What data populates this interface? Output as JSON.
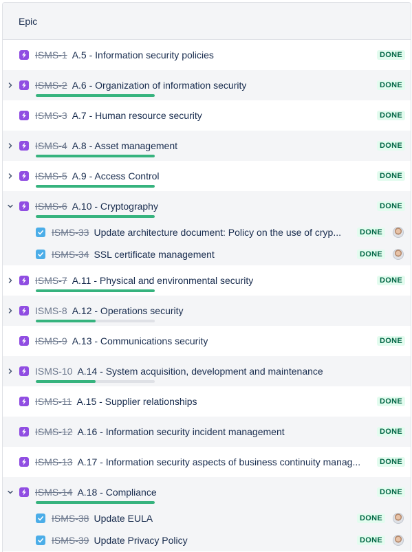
{
  "header": {
    "label": "Epic"
  },
  "status_done": "DONE",
  "colors": {
    "epic": "#904ee2",
    "task": "#4bade8",
    "done_text": "#006644",
    "done_bg": "#e3fcef",
    "progress": "#36b37e",
    "track": "#dfe1e6"
  },
  "rows": [
    {
      "type": "epic",
      "key": "ISMS-1",
      "summary": "A.5 - Information security policies",
      "done": true,
      "status": "DONE",
      "chevron": "none",
      "progress": null
    },
    {
      "type": "epic",
      "key": "ISMS-2",
      "summary": "A.6 - Organization of information security",
      "done": true,
      "status": "DONE",
      "chevron": "right",
      "progress": 1.0
    },
    {
      "type": "epic",
      "key": "ISMS-3",
      "summary": "A.7 - Human resource security",
      "done": true,
      "status": "DONE",
      "chevron": "none",
      "progress": null
    },
    {
      "type": "epic",
      "key": "ISMS-4",
      "summary": "A.8 - Asset management",
      "done": true,
      "status": "DONE",
      "chevron": "right",
      "progress": 1.0
    },
    {
      "type": "epic",
      "key": "ISMS-5",
      "summary": "A.9 - Access Control",
      "done": true,
      "status": "DONE",
      "chevron": "right",
      "progress": 1.0
    },
    {
      "type": "epic",
      "key": "ISMS-6",
      "summary": "A.10 - Cryptography",
      "done": true,
      "status": "DONE",
      "chevron": "down",
      "progress": 1.0
    },
    {
      "type": "child",
      "key": "ISMS-33",
      "summary": "Update architecture document: Policy on the use of cryp...",
      "done": true,
      "status": "DONE",
      "avatar": true
    },
    {
      "type": "child",
      "key": "ISMS-34",
      "summary": "SSL certificate management",
      "done": true,
      "status": "DONE",
      "avatar": true
    },
    {
      "type": "epic",
      "key": "ISMS-7",
      "summary": "A.11 - Physical and environmental security",
      "done": true,
      "status": "DONE",
      "chevron": "right",
      "progress": 1.0
    },
    {
      "type": "epic",
      "key": "ISMS-8",
      "summary": "A.12 - Operations security",
      "done": false,
      "status": "",
      "chevron": "right",
      "progress": 0.5
    },
    {
      "type": "epic",
      "key": "ISMS-9",
      "summary": "A.13 - Communications security",
      "done": true,
      "status": "DONE",
      "chevron": "none",
      "progress": null
    },
    {
      "type": "epic",
      "key": "ISMS-10",
      "summary": "A.14 - System acquisition, development and maintenance",
      "done": false,
      "status": "",
      "chevron": "right",
      "progress": 0.5
    },
    {
      "type": "epic",
      "key": "ISMS-11",
      "summary": "A.15 - Supplier relationships",
      "done": true,
      "status": "DONE",
      "chevron": "none",
      "progress": null
    },
    {
      "type": "epic",
      "key": "ISMS-12",
      "summary": "A.16 - Information security incident management",
      "done": true,
      "status": "DONE",
      "chevron": "none",
      "progress": null
    },
    {
      "type": "epic",
      "key": "ISMS-13",
      "summary": "A.17 - Information security aspects of business continuity manag...",
      "done": true,
      "status": "DONE",
      "chevron": "none",
      "progress": null
    },
    {
      "type": "epic",
      "key": "ISMS-14",
      "summary": "A.18 - Compliance",
      "done": true,
      "status": "DONE",
      "chevron": "down",
      "progress": 1.0
    },
    {
      "type": "child",
      "key": "ISMS-38",
      "summary": "Update EULA",
      "done": true,
      "status": "DONE",
      "avatar": true
    },
    {
      "type": "child",
      "key": "ISMS-39",
      "summary": "Update Privacy Policy",
      "done": true,
      "status": "DONE",
      "avatar": true
    }
  ]
}
